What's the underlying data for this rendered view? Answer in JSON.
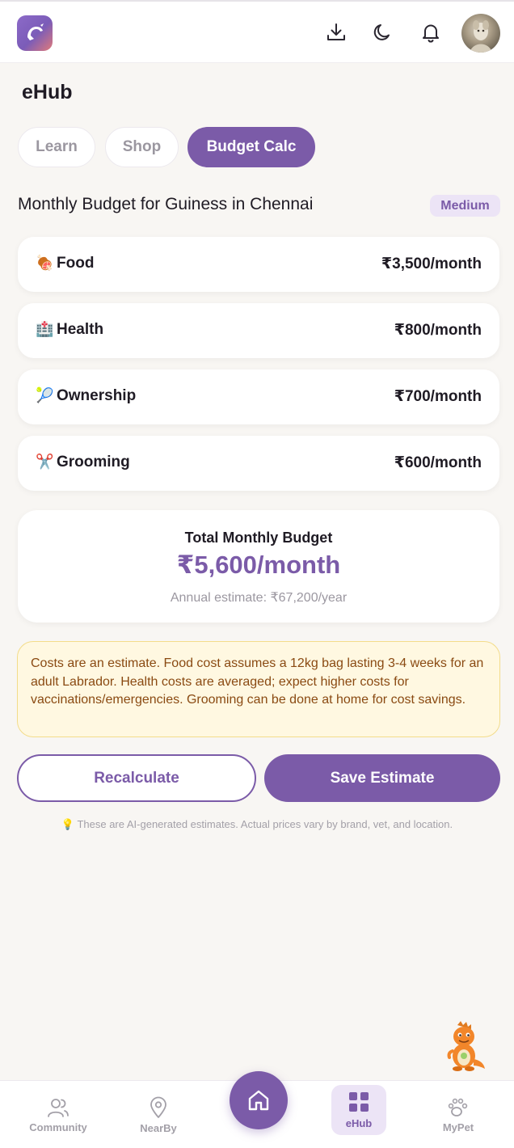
{
  "header": {
    "icons": [
      "download-icon",
      "moon-icon",
      "bell-icon"
    ]
  },
  "page": {
    "title": "eHub"
  },
  "tabs": [
    {
      "label": "Learn",
      "active": false
    },
    {
      "label": "Shop",
      "active": false
    },
    {
      "label": "Budget Calc",
      "active": true
    }
  ],
  "budget": {
    "title": "Monthly Budget for Guiness in Chennai",
    "level": "Medium",
    "items": [
      {
        "emoji": "🍖",
        "label": "Food",
        "value": "₹3,500/month"
      },
      {
        "emoji": "🏥",
        "label": "Health",
        "value": "₹800/month"
      },
      {
        "emoji": "🎾",
        "label": "Ownership",
        "value": "₹700/month"
      },
      {
        "emoji": "✂️",
        "label": "Grooming",
        "value": "₹600/month"
      }
    ],
    "total_label": "Total Monthly Budget",
    "total_value": "₹5,600/month",
    "annual": "Annual estimate: ₹67,200/year",
    "note": "Costs are an estimate. Food cost assumes a 12kg bag lasting 3-4 weeks for an adult Labrador. Health costs are averaged; expect higher costs for vaccinations/emergencies. Grooming can be done at home for cost savings.",
    "recalculate_label": "Recalculate",
    "save_label": "Save Estimate",
    "disclaimer": "💡 These are AI-generated estimates. Actual prices vary by brand, vet, and location."
  },
  "nav": {
    "items": [
      {
        "label": "Community",
        "icon": "community-icon"
      },
      {
        "label": "NearBy",
        "icon": "location-pin-icon"
      },
      {
        "label": "eHub",
        "icon": "grid-icon",
        "active": true
      },
      {
        "label": "MyPet",
        "icon": "paw-icon"
      }
    ],
    "home_icon": "home-icon"
  },
  "colors": {
    "accent": "#7b5ba8",
    "background": "#f8f6f3",
    "note_bg": "#fff8e1",
    "note_text": "#8a4a12"
  }
}
